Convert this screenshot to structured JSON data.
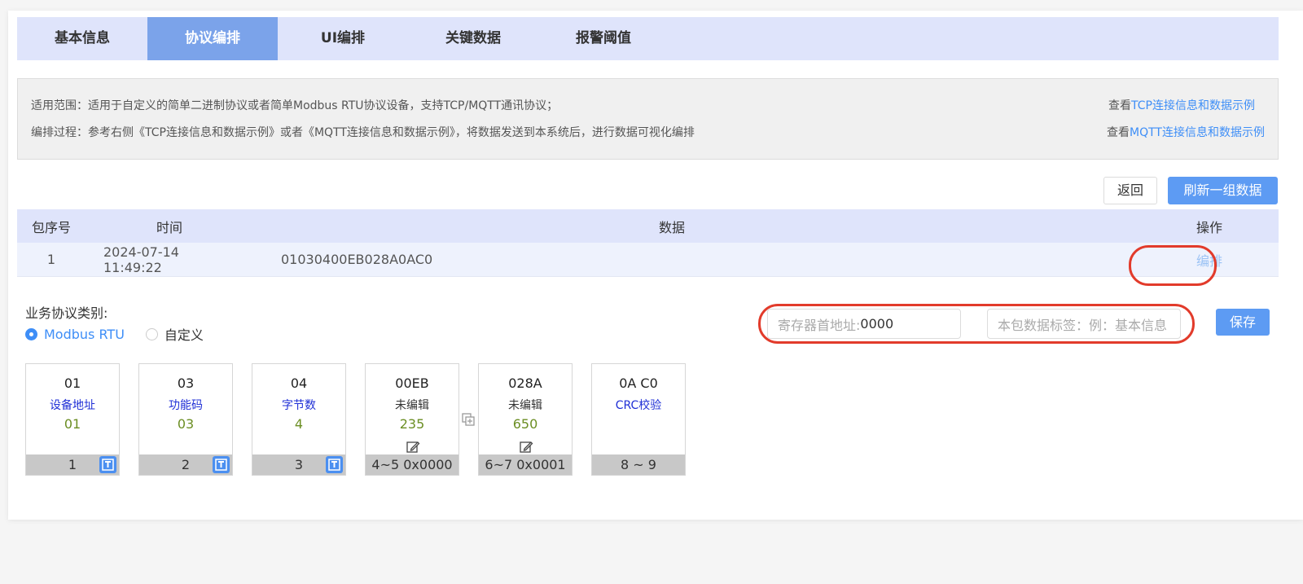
{
  "tabs": [
    {
      "label": "基本信息",
      "active": false
    },
    {
      "label": "协议编排",
      "active": true
    },
    {
      "label": "UI编排",
      "active": false
    },
    {
      "label": "关键数据",
      "active": false
    },
    {
      "label": "报警阈值",
      "active": false
    }
  ],
  "info": {
    "scope_text": "适用范围：适用于自定义的简单二进制协议或者简单Modbus RTU协议设备，支持TCP/MQTT通讯协议；",
    "process_text": "编排过程：参考右侧《TCP连接信息和数据示例》或者《MQTT连接信息和数据示例》，将数据发送到本系统后，进行数据可视化编排",
    "view_prefix_1": "查看",
    "tcp_link": "TCP连接信息和数据示例",
    "view_prefix_2": "查看",
    "mqtt_link": "MQTT连接信息和数据示例"
  },
  "toolbar": {
    "back_label": "返回",
    "refresh_label": "刷新一组数据"
  },
  "table": {
    "headers": {
      "seq": "包序号",
      "time": "时间",
      "data": "数据",
      "op": "操作"
    },
    "rows": [
      {
        "seq": "1",
        "time": "2024-07-14 11:49:22",
        "data": "01030400EB028A0AC0",
        "op": "编排"
      }
    ]
  },
  "protocol": {
    "label": "业务协议类别:",
    "options": [
      {
        "label": "Modbus RTU",
        "selected": true
      },
      {
        "label": "自定义",
        "selected": false
      }
    ],
    "register_prefix": "寄存器首地址:",
    "register_value": "0000",
    "tag_placeholder": "本包数据标签：例：基本信息",
    "save_label": "保存"
  },
  "blocks": [
    {
      "hex": "01",
      "name": "设备地址",
      "value": "01",
      "foot": "1",
      "badge": true
    },
    {
      "hex": "03",
      "name": "功能码",
      "value": "03",
      "foot": "2",
      "badge": true
    },
    {
      "hex": "04",
      "name": "字节数",
      "value": "4",
      "foot": "3",
      "badge": true
    },
    {
      "hex": "00EB",
      "name": "未编辑",
      "value": "235",
      "foot": "4~5 0x0000",
      "editable": true
    },
    {
      "hex": "028A",
      "name": "未编辑",
      "value": "650",
      "foot": "6~7 0x0001",
      "editable": true
    },
    {
      "hex": "0A C0",
      "name": "CRC校验",
      "value": "",
      "foot": "8 ~ 9"
    }
  ],
  "colors": {
    "accent": "#5d9bf3",
    "tab_bg": "#dfe4fb",
    "tab_active": "#7ba3ea",
    "highlight": "#e23b2b",
    "value_green": "#6b8e23",
    "name_blue": "#1f2fd6"
  }
}
